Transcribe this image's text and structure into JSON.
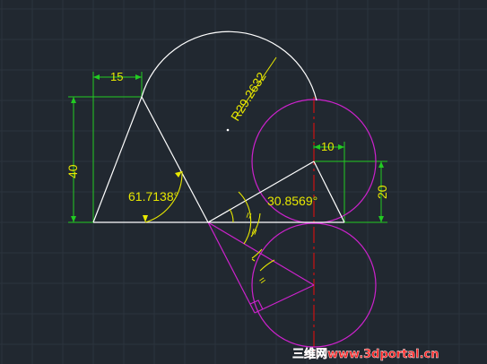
{
  "colors": {
    "background": "#212830",
    "grid": "#2c343e",
    "geometry": "#ffffff",
    "circles": "#cc22cc",
    "dimension_lines": "#22cc22",
    "dimension_text": "#e8e800",
    "centerline": "#cc1111",
    "watermark": "#ff2222"
  },
  "dimensions": {
    "top_width": "15",
    "height": "40",
    "radius": "R29.2632",
    "right_width": "10",
    "right_height": "20",
    "angle_left": "61.7138°",
    "angle_right": "30.8569°",
    "equal_mark_1": "=",
    "equal_mark_2": "=",
    "equal_mark_3": "="
  },
  "watermark": {
    "text": "三维网www.3dportal.cn"
  }
}
